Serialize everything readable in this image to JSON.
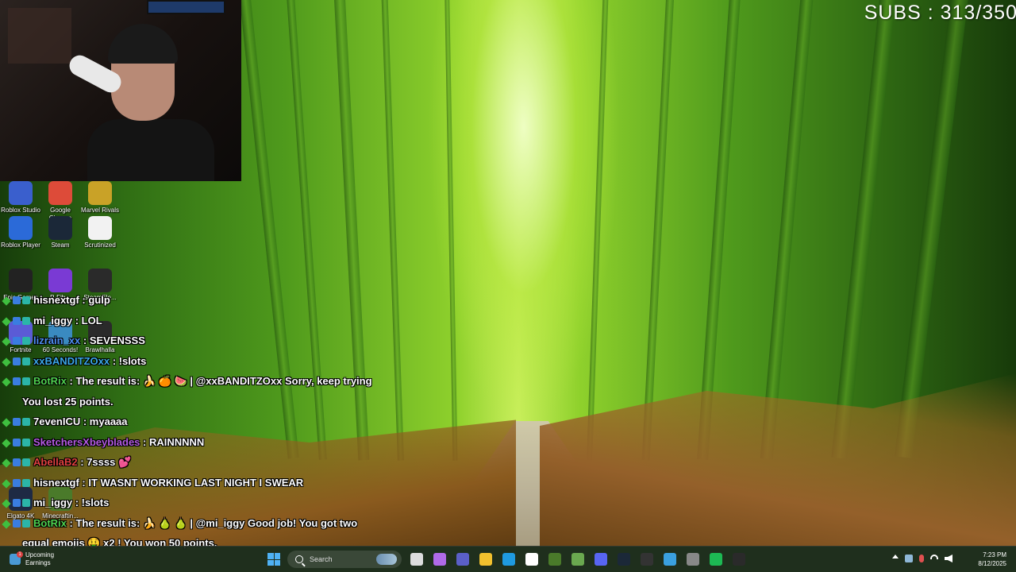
{
  "overlay": {
    "subs_label": "SUBS : 313/350"
  },
  "desktop_icons": [
    {
      "label": "Roblox Studio",
      "icon": "roblox-studio-icon",
      "color": "#3a5fcd"
    },
    {
      "label": "Google Chrome",
      "icon": "chrome-icon",
      "color": "#dd4b39"
    },
    {
      "label": "Marvel Rivals",
      "icon": "marvel-rivals-icon",
      "color": "#c9a227"
    },
    {
      "label": "Roblox Player",
      "icon": "roblox-player-icon",
      "color": "#2b6ad8"
    },
    {
      "label": "Steam",
      "icon": "steam-icon",
      "color": "#1b2838"
    },
    {
      "label": "Scrutinized",
      "icon": "document-icon",
      "color": "#f2f2f2"
    },
    {
      "label": "Epic Games",
      "icon": "epic-games-icon",
      "color": "#222222"
    },
    {
      "label": "P-Fib...",
      "icon": "emoji-icon",
      "color": "#7a3ad4"
    },
    {
      "label": "SteamEle...",
      "icon": "streamelements-icon",
      "color": "#2a2a2a"
    },
    {
      "label": "Fortnite",
      "icon": "fortnite-icon",
      "color": "#5b5bd6"
    },
    {
      "label": "60 Seconds!",
      "icon": "sixty-seconds-icon",
      "color": "#3a8ac0"
    },
    {
      "label": "Brawlhalla",
      "icon": "brawlhalla-icon",
      "color": "#2a2a2a"
    },
    {
      "label": "Elgato 4K",
      "icon": "elgato-icon",
      "color": "#1e2a44"
    },
    {
      "label": "Minecraftin...",
      "icon": "minecraft-icon",
      "color": "#4a7a2a"
    }
  ],
  "chat": [
    {
      "user": "hisnextgf",
      "user_color": "#ffffff",
      "text": " : gulp"
    },
    {
      "user": "mi_iggy",
      "user_color": "#ffffff",
      "text": " : LOL"
    },
    {
      "user": "lizrain_xx",
      "user_color": "#4d8ef0",
      "text": " : SEVENSSS"
    },
    {
      "user": "xxBANDITZOxx",
      "user_color": "#3ba7e8",
      "text": " : !slots"
    },
    {
      "user": "BotRix",
      "user_color": "#4fd14f",
      "text": " : The result is: 🍌 🍊 🍉 | @xxBANDITZOxx Sorry, keep trying"
    },
    {
      "user": "",
      "user_color": "#ffffff",
      "text": "You lost 25 points."
    },
    {
      "user": "7evenICU",
      "user_color": "#ffffff",
      "text": " : myaaaa"
    },
    {
      "user": "SketchersXbeyblades",
      "user_color": "#b35ae0",
      "text": " : RAINNNNN"
    },
    {
      "user": "AbellaB2",
      "user_color": "#e04040",
      "text": " : 7ssss 💕"
    },
    {
      "user": "hisnextgf",
      "user_color": "#ffffff",
      "text": " : IT WASNT WORKING LAST NIGHT I SWEAR"
    },
    {
      "user": "mi_iggy",
      "user_color": "#ffffff",
      "text": " : !slots"
    },
    {
      "user": "BotRix",
      "user_color": "#4fd14f",
      "text": " : The result is: 🍌 🍐 🍐 | @mi_iggy Good job! You got two"
    },
    {
      "user": "",
      "user_color": "#ffffff",
      "text": "equal emojis 🤑 x2 ! You won 50 points."
    }
  ],
  "taskbar": {
    "weather_title": "Upcoming",
    "weather_subtitle": "Earnings",
    "weather_badge": "1",
    "search_placeholder": "Search",
    "apps": [
      {
        "icon": "task-view-icon",
        "color": "#dddddd"
      },
      {
        "icon": "copilot-icon",
        "color": "#b06ae8"
      },
      {
        "icon": "teams-icon",
        "color": "#5b5fc7"
      },
      {
        "icon": "file-explorer-icon",
        "color": "#f2c12e"
      },
      {
        "icon": "edge-icon",
        "color": "#1f9ae0"
      },
      {
        "icon": "store-icon",
        "color": "#ffffff"
      },
      {
        "icon": "minecraft-icon",
        "color": "#4a7a2a"
      },
      {
        "icon": "green-app-icon",
        "color": "#6aa84f"
      },
      {
        "icon": "discord-icon",
        "color": "#5865f2"
      },
      {
        "icon": "steam-icon",
        "color": "#1b2838"
      },
      {
        "icon": "obs-icon",
        "color": "#333333"
      },
      {
        "icon": "photos-icon",
        "color": "#3aa0e0"
      },
      {
        "icon": "settings-icon",
        "color": "#888888"
      },
      {
        "icon": "spotify-icon",
        "color": "#1db954"
      },
      {
        "icon": "elgato-4k-icon",
        "color": "#2a2a2a"
      }
    ],
    "time": "7:23 PM",
    "date": "8/12/2025"
  }
}
